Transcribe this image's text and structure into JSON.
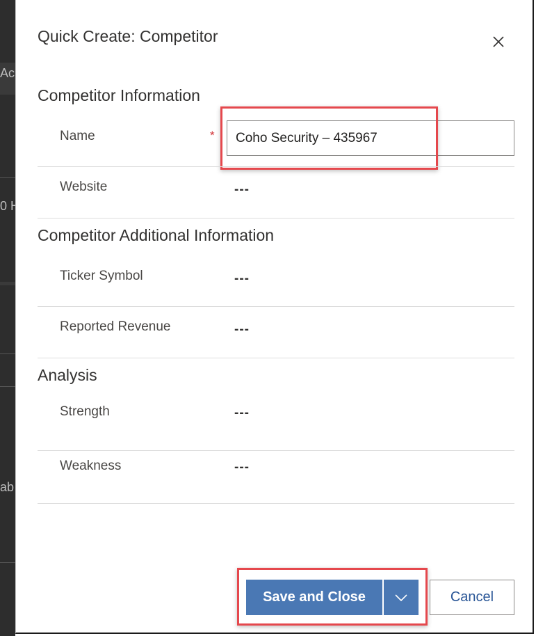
{
  "background": {
    "fragments": [
      "Ac",
      "0 H",
      "ab"
    ]
  },
  "dialog": {
    "title": "Quick Create: Competitor",
    "close_icon": "close-icon"
  },
  "sections": {
    "competitor_information": {
      "title": "Competitor Information",
      "name": {
        "label": "Name",
        "required_marker": "*",
        "value": "Coho Security – 435967"
      },
      "website": {
        "label": "Website",
        "value": "---"
      }
    },
    "additional_information": {
      "title": "Competitor Additional Information",
      "ticker_symbol": {
        "label": "Ticker Symbol",
        "value": "---"
      },
      "reported_revenue": {
        "label": "Reported Revenue",
        "value": "---"
      }
    },
    "analysis": {
      "title": "Analysis",
      "strength": {
        "label": "Strength",
        "value": "---"
      },
      "weakness": {
        "label": "Weakness",
        "value": "---"
      }
    }
  },
  "footer": {
    "save_label": "Save and Close",
    "dropdown_icon": "chevron-down-icon",
    "cancel_label": "Cancel"
  },
  "colors": {
    "primary": "#4a78b4",
    "highlight": "#e5484d",
    "required": "#d13438"
  }
}
